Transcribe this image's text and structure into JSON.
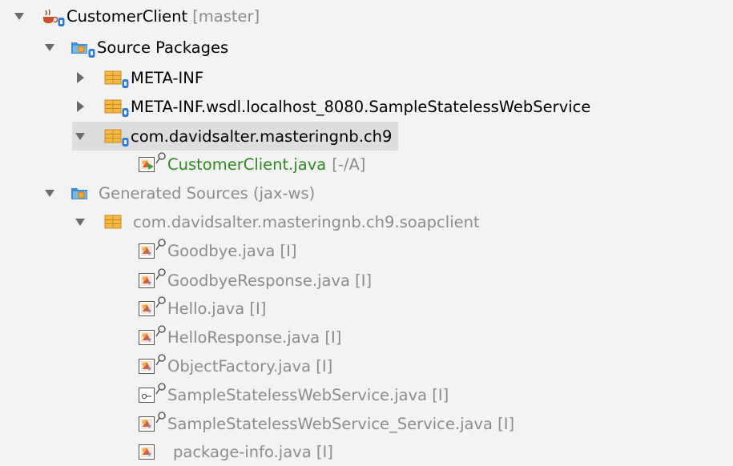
{
  "tree": {
    "project": {
      "label": "CustomerClient",
      "suffix": "[master]"
    },
    "source_packages": {
      "label": "Source Packages"
    },
    "meta_inf": {
      "label": "META-INF"
    },
    "meta_inf_wsdl": {
      "label": "META-INF.wsdl.localhost_8080.SampleStatelessWebService"
    },
    "pkg_ch9": {
      "label": "com.davidsalter.masteringnb.ch9"
    },
    "customer_client_java": {
      "label": "CustomerClient.java",
      "suffix": "[-/A]"
    },
    "generated_sources": {
      "label": "Generated Sources (jax-ws)"
    },
    "pkg_soapclient": {
      "label": "com.davidsalter.masteringnb.ch9.soapclient"
    },
    "files": [
      {
        "label": "Goodbye.java [I]"
      },
      {
        "label": "GoodbyeResponse.java [I]"
      },
      {
        "label": "Hello.java [I]"
      },
      {
        "label": "HelloResponse.java [I]"
      },
      {
        "label": "ObjectFactory.java [I]"
      },
      {
        "label": "SampleStatelessWebService.java [I]"
      },
      {
        "label": "SampleStatelessWebService_Service.java [I]"
      },
      {
        "label": "package-info.java [I]"
      }
    ]
  },
  "colors": {
    "background": "#f3f3f3",
    "selection": "#dddddd",
    "dim_text": "#8c8c8c",
    "modified_text": "#2b8a1e",
    "folder_blue": "#3d8fd6",
    "package_orange": "#f0a830"
  }
}
